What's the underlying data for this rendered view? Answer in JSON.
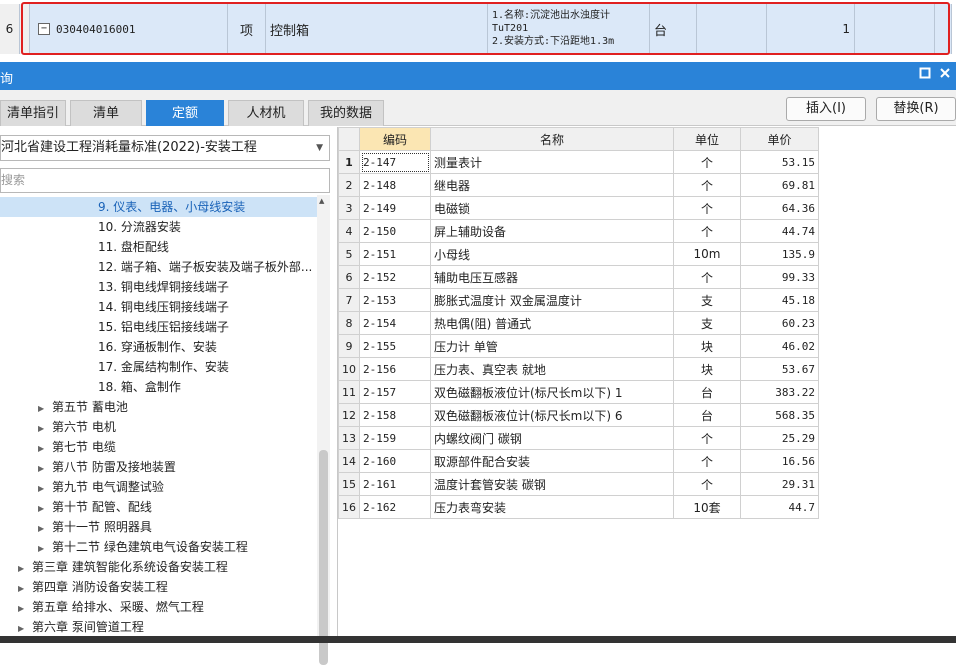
{
  "top_row": {
    "row_no": "6",
    "collapse_glyph": "−",
    "code": "030404016001",
    "kind": "项",
    "name": "控制箱",
    "description_lines": [
      "1.名称:沉淀池出水浊度计",
      "TuT201",
      "2.安装方式:下沿距地1.3m"
    ],
    "unit": "台",
    "quantity": "1"
  },
  "window": {
    "title": "询",
    "restore_icon": "window-restore-icon",
    "close_icon": "close-icon"
  },
  "tabs": [
    {
      "label": "清单指引",
      "active": false
    },
    {
      "label": "清单",
      "active": false
    },
    {
      "label": "定额",
      "active": true
    },
    {
      "label": "人材机",
      "active": false
    },
    {
      "label": "我的数据",
      "active": false
    }
  ],
  "buttons": {
    "insert": "插入(I)",
    "replace": "替换(R)"
  },
  "left": {
    "library": "河北省建设工程消耗量标准(2022)-安装工程",
    "search_placeholder": "搜索",
    "tree": [
      {
        "label": "9. 仪表、电器、小母线安装",
        "level": 3,
        "selected": true,
        "expandable": false
      },
      {
        "label": "10. 分流器安装",
        "level": 3,
        "expandable": false
      },
      {
        "label": "11. 盘柜配线",
        "level": 3,
        "expandable": false
      },
      {
        "label": "12. 端子箱、端子板安装及端子板外部...",
        "level": 3,
        "expandable": false
      },
      {
        "label": "13. 铜电线焊铜接线端子",
        "level": 3,
        "expandable": false
      },
      {
        "label": "14. 铜电线压铜接线端子",
        "level": 3,
        "expandable": false
      },
      {
        "label": "15. 铝电线压铝接线端子",
        "level": 3,
        "expandable": false
      },
      {
        "label": "16. 穿通板制作、安装",
        "level": 3,
        "expandable": false
      },
      {
        "label": "17. 金属结构制作、安装",
        "level": 3,
        "expandable": false
      },
      {
        "label": "18. 箱、盒制作",
        "level": 3,
        "expandable": false
      },
      {
        "label": "第五节 蓄电池",
        "level": 2,
        "expandable": true
      },
      {
        "label": "第六节 电机",
        "level": 2,
        "expandable": true
      },
      {
        "label": "第七节 电缆",
        "level": 2,
        "expandable": true
      },
      {
        "label": "第八节 防雷及接地装置",
        "level": 2,
        "expandable": true
      },
      {
        "label": "第九节 电气调整试验",
        "level": 2,
        "expandable": true
      },
      {
        "label": "第十节 配管、配线",
        "level": 2,
        "expandable": true
      },
      {
        "label": "第十一节 照明器具",
        "level": 2,
        "expandable": true
      },
      {
        "label": "第十二节 绿色建筑电气设备安装工程",
        "level": 2,
        "expandable": true
      },
      {
        "label": "第三章 建筑智能化系统设备安装工程",
        "level": 1,
        "expandable": true
      },
      {
        "label": "第四章 消防设备安装工程",
        "level": 1,
        "expandable": true
      },
      {
        "label": "第五章 给排水、采暖、燃气工程",
        "level": 1,
        "expandable": true
      },
      {
        "label": "第六章 泵间管道工程",
        "level": 1,
        "expandable": true
      }
    ]
  },
  "grid": {
    "headers": {
      "code": "编码",
      "name": "名称",
      "unit": "单位",
      "price": "单价"
    },
    "rows": [
      {
        "n": "1",
        "code": "2-147",
        "name": "测量表计",
        "unit": "个",
        "price": "53.15"
      },
      {
        "n": "2",
        "code": "2-148",
        "name": "继电器",
        "unit": "个",
        "price": "69.81"
      },
      {
        "n": "3",
        "code": "2-149",
        "name": "电磁锁",
        "unit": "个",
        "price": "64.36"
      },
      {
        "n": "4",
        "code": "2-150",
        "name": "屏上辅助设备",
        "unit": "个",
        "price": "44.74"
      },
      {
        "n": "5",
        "code": "2-151",
        "name": "小母线",
        "unit": "10m",
        "price": "135.9"
      },
      {
        "n": "6",
        "code": "2-152",
        "name": "辅助电压互感器",
        "unit": "个",
        "price": "99.33"
      },
      {
        "n": "7",
        "code": "2-153",
        "name": "膨胀式温度计 双金属温度计",
        "unit": "支",
        "price": "45.18"
      },
      {
        "n": "8",
        "code": "2-154",
        "name": "热电偶(阻) 普通式",
        "unit": "支",
        "price": "60.23"
      },
      {
        "n": "9",
        "code": "2-155",
        "name": "压力计 单管",
        "unit": "块",
        "price": "46.02"
      },
      {
        "n": "10",
        "code": "2-156",
        "name": "压力表、真空表 就地",
        "unit": "块",
        "price": "53.67"
      },
      {
        "n": "11",
        "code": "2-157",
        "name": "双色磁翻板液位计(标尺长m以下) 1",
        "unit": "台",
        "price": "383.22"
      },
      {
        "n": "12",
        "code": "2-158",
        "name": "双色磁翻板液位计(标尺长m以下) 6",
        "unit": "台",
        "price": "568.35"
      },
      {
        "n": "13",
        "code": "2-159",
        "name": "内螺纹阀门 碳钢",
        "unit": "个",
        "price": "25.29"
      },
      {
        "n": "14",
        "code": "2-160",
        "name": "取源部件配合安装",
        "unit": "个",
        "price": "16.56"
      },
      {
        "n": "15",
        "code": "2-161",
        "name": "温度计套管安装 碳钢",
        "unit": "个",
        "price": "29.31"
      },
      {
        "n": "16",
        "code": "2-162",
        "name": "压力表弯安装",
        "unit": "10套",
        "price": "44.7"
      }
    ]
  }
}
